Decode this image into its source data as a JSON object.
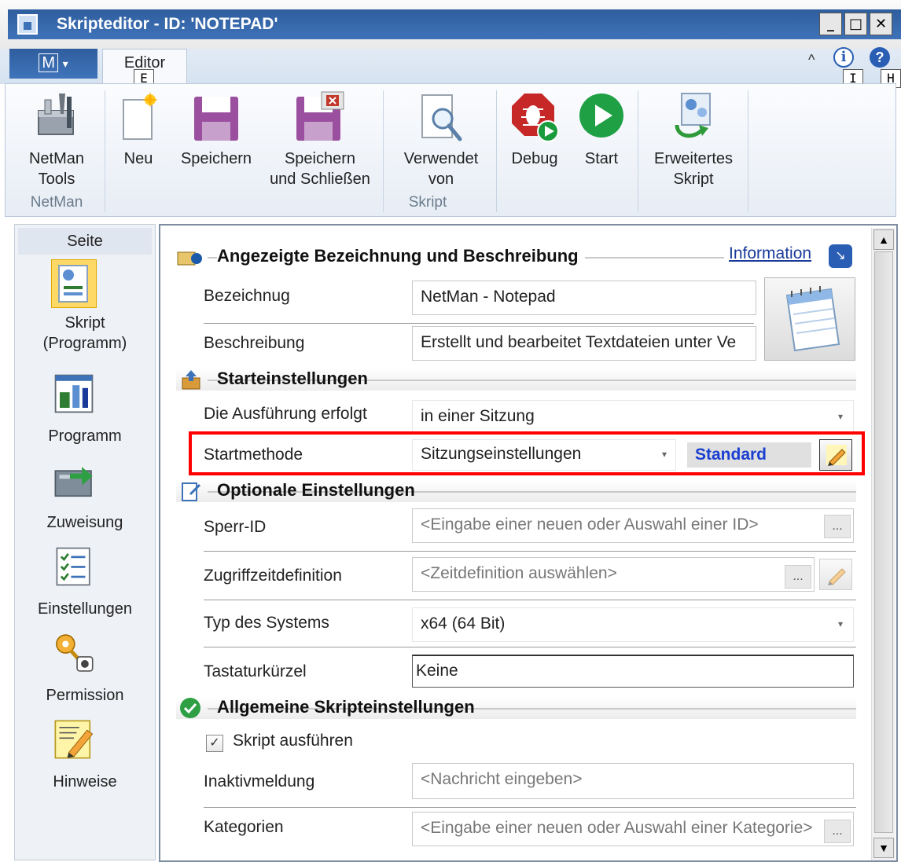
{
  "window": {
    "title": "Skripteditor - ID: 'NOTEPAD'",
    "minimize": "_",
    "maximize": "□",
    "close": "✕"
  },
  "tabs": {
    "menu_label": "M",
    "menu_arrow": "▾",
    "editor_label": "Editor",
    "editor_keytip": "E",
    "info_keytip": "I",
    "help_keytip": "H",
    "collapse": "^"
  },
  "ribbon": {
    "netman_tools": "NetMan\nTools",
    "neu": "Neu",
    "speichern": "Speichern",
    "speichern_schliessen": "Speichern\nund Schließen",
    "verwendet_von": "Verwendet\nvon",
    "debug": "Debug",
    "start": "Start",
    "erweitertes_skript": "Erweitertes\nSkript",
    "group_netman": "NetMan",
    "group_skript": "Skript"
  },
  "nav": {
    "header": "Seite",
    "items": [
      {
        "label": "Skript\n(Programm)",
        "icon": "script-icon",
        "selected": true
      },
      {
        "label": "Programm",
        "icon": "program-icon"
      },
      {
        "label": "Zuweisung",
        "icon": "assignment-icon"
      },
      {
        "label": "Einstellungen",
        "icon": "settings-list-icon"
      },
      {
        "label": "Permission",
        "icon": "key-lock-icon"
      },
      {
        "label": "Hinweise",
        "icon": "notes-icon"
      }
    ]
  },
  "content": {
    "section1": {
      "title": "Angezeigte Bezeichnung und Beschreibung",
      "info_link": "Information",
      "bezeichnung_label": "Bezeichnug",
      "bezeichnung_value": "NetMan - Notepad",
      "beschreibung_label": "Beschreibung",
      "beschreibung_value": "Erstellt und bearbeitet Textdateien unter Ve"
    },
    "section2": {
      "title": "Starteinstellungen",
      "ausfuehrung_label": "Die Ausführung erfolgt",
      "ausfuehrung_value": "in einer Sitzung",
      "startmethode_label": "Startmethode",
      "startmethode_value": "Sitzungseinstellungen",
      "standard_label": "Standard"
    },
    "section3": {
      "title": "Optionale Einstellungen",
      "sperr_label": "Sperr-ID",
      "sperr_placeholder": "<Eingabe einer neuen oder Auswahl einer ID>",
      "zugriff_label": "Zugriffzeitdefinition",
      "zugriff_placeholder": "<Zeitdefinition auswählen>",
      "typ_label": "Typ des Systems",
      "typ_value": "x64 (64 Bit)",
      "tastatur_label": "Tastaturkürzel",
      "tastatur_value": "Keine"
    },
    "section4": {
      "title": "Allgemeine Skripteinstellungen",
      "skript_ausfuehren_label": "Skript ausführen",
      "skript_ausfuehren_checked": true,
      "inaktiv_label": "Inaktivmeldung",
      "inaktiv_placeholder": "<Nachricht eingeben>",
      "kategorien_label": "Kategorien",
      "kategorien_placeholder": "<Eingabe einer neuen oder Auswahl einer Kategorie>"
    },
    "dots": "...",
    "dd_arrow": "▾"
  },
  "colors": {
    "title_bar": "#2f5e9e",
    "highlight_box": "#ff0000",
    "standard_text": "#1a3fd0",
    "link": "#1a3a9a"
  }
}
